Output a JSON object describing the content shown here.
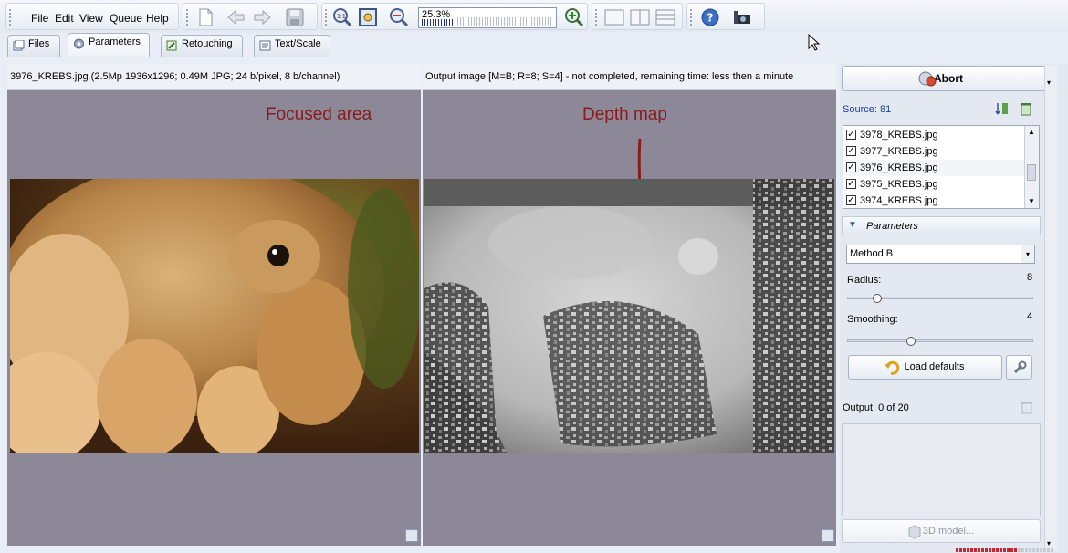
{
  "menu": {
    "file": "File",
    "edit": "Edit",
    "view": "View",
    "queue": "Queue",
    "help": "Help"
  },
  "toolbar": {
    "zoom_value": "25.3%",
    "zoom_level": 0.253
  },
  "tabs": [
    {
      "label": "Files"
    },
    {
      "label": "Parameters"
    },
    {
      "label": "Retouching"
    },
    {
      "label": "Text/Scale"
    }
  ],
  "left_panel": {
    "header": "3976_KREBS.jpg (2.5Mp 1936x1296; 0.49M JPG; 24 b/pixel, 8 b/channel)",
    "annotation": "Focused area"
  },
  "right_panel": {
    "header": "Output image [M=B; R=8; S=4] - not completed, remaining time: less then a minute",
    "annotation": "Depth map"
  },
  "sidebar": {
    "abort_label": "Abort",
    "source_label": "Source: 81",
    "source_files": [
      {
        "name": "3978_KREBS.jpg",
        "checked": true
      },
      {
        "name": "3977_KREBS.jpg",
        "checked": true
      },
      {
        "name": "3976_KREBS.jpg",
        "checked": true
      },
      {
        "name": "3975_KREBS.jpg",
        "checked": true
      },
      {
        "name": "3974_KREBS.jpg",
        "checked": true
      }
    ],
    "parameters_label": "Parameters",
    "method_value": "Method B",
    "radius_label": "Radius:",
    "radius_value": "8",
    "smoothing_label": "Smoothing:",
    "smoothing_value": "4",
    "load_defaults_label": "Load defaults",
    "output_label": "Output: 0 of 20",
    "model_label": "3D model..."
  },
  "colors": {
    "annotation": "#8b1a1a",
    "zoom_tick_active": "#1c2d8c",
    "zoom_tick_current": "#c0282a"
  }
}
